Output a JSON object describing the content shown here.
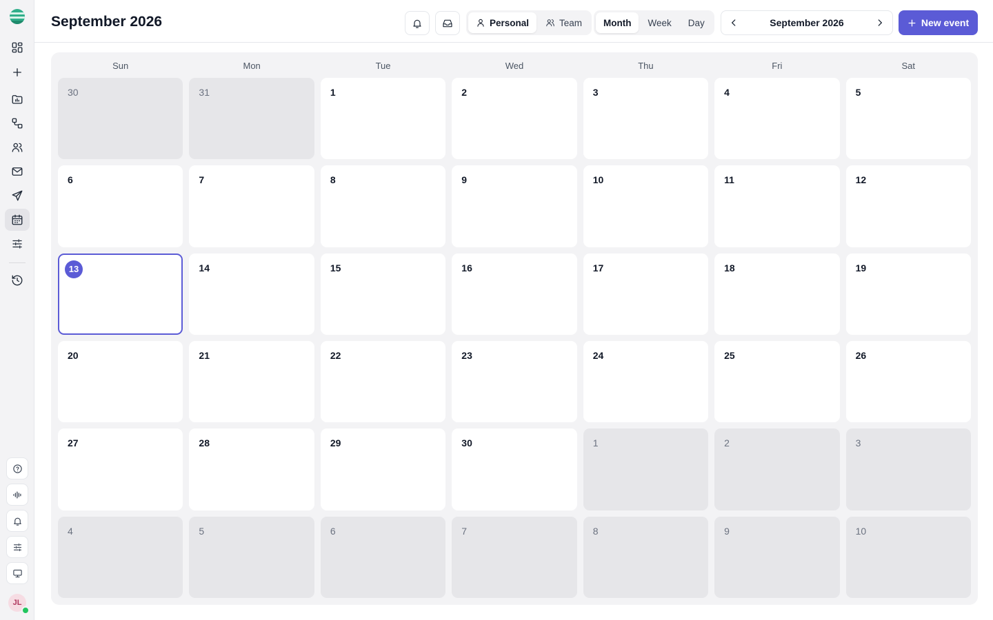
{
  "header": {
    "title": "September 2026",
    "scope_tabs": [
      {
        "label": "Personal",
        "icon": "user-icon",
        "active": true
      },
      {
        "label": "Team",
        "icon": "users-icon",
        "active": false
      }
    ],
    "view_tabs": [
      {
        "label": "Month",
        "active": true
      },
      {
        "label": "Week",
        "active": false
      },
      {
        "label": "Day",
        "active": false
      }
    ],
    "nav_label": "September 2026",
    "new_event_label": "New event"
  },
  "sidebar": {
    "nav_icons": [
      "dashboard-icon",
      "plus-icon",
      "folder-chart-icon",
      "workflow-icon",
      "users-icon",
      "mail-icon",
      "send-icon",
      "calendar-icon",
      "sliders-icon",
      "history-icon"
    ],
    "active_item": "calendar-icon",
    "bottom_icons": [
      "help-icon",
      "audio-wave-icon",
      "bell-icon",
      "sliders-icon",
      "monitor-icon"
    ],
    "avatar_initials": "JL"
  },
  "calendar": {
    "weekdays": [
      "Sun",
      "Mon",
      "Tue",
      "Wed",
      "Thu",
      "Fri",
      "Sat"
    ],
    "today": "13",
    "days": [
      {
        "n": "30",
        "other": true
      },
      {
        "n": "31",
        "other": true
      },
      {
        "n": "1"
      },
      {
        "n": "2"
      },
      {
        "n": "3"
      },
      {
        "n": "4"
      },
      {
        "n": "5"
      },
      {
        "n": "6"
      },
      {
        "n": "7"
      },
      {
        "n": "8"
      },
      {
        "n": "9"
      },
      {
        "n": "10"
      },
      {
        "n": "11"
      },
      {
        "n": "12"
      },
      {
        "n": "13",
        "today": true
      },
      {
        "n": "14"
      },
      {
        "n": "15"
      },
      {
        "n": "16"
      },
      {
        "n": "17"
      },
      {
        "n": "18"
      },
      {
        "n": "19"
      },
      {
        "n": "20"
      },
      {
        "n": "21"
      },
      {
        "n": "22"
      },
      {
        "n": "23"
      },
      {
        "n": "24"
      },
      {
        "n": "25"
      },
      {
        "n": "26"
      },
      {
        "n": "27"
      },
      {
        "n": "28"
      },
      {
        "n": "29"
      },
      {
        "n": "30"
      },
      {
        "n": "1",
        "other": true
      },
      {
        "n": "2",
        "other": true
      },
      {
        "n": "3",
        "other": true
      },
      {
        "n": "4",
        "other": true
      },
      {
        "n": "5",
        "other": true
      },
      {
        "n": "6",
        "other": true
      },
      {
        "n": "7",
        "other": true
      },
      {
        "n": "8",
        "other": true
      },
      {
        "n": "9",
        "other": true
      },
      {
        "n": "10",
        "other": true
      }
    ]
  },
  "colors": {
    "accent": "#5b5bd6",
    "other_month_bg": "#e6e6e9",
    "calendar_bg": "#f3f3f5",
    "presence": "#22c55e"
  }
}
